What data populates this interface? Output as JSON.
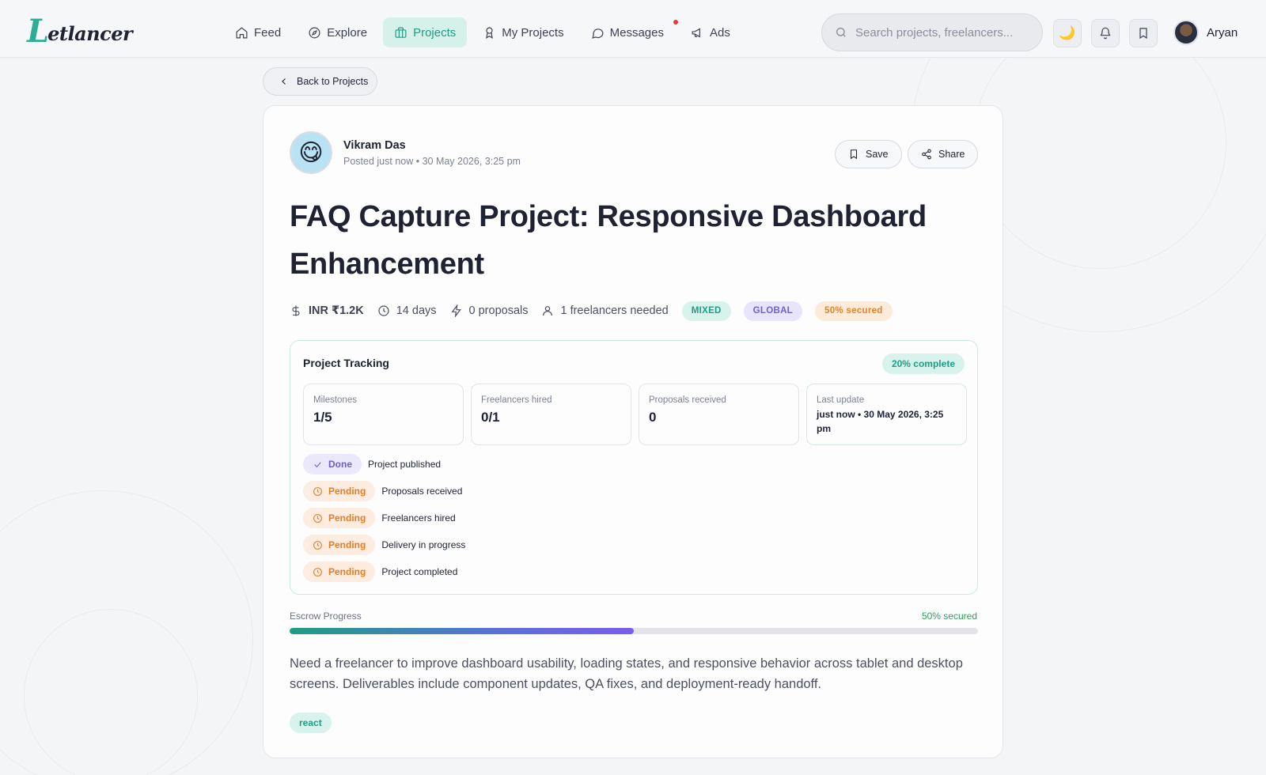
{
  "brand": {
    "logo_initial": "L",
    "logo_rest": "etlancer"
  },
  "nav": {
    "feed": "Feed",
    "explore": "Explore",
    "projects": "Projects",
    "my_projects": "My Projects",
    "messages": "Messages",
    "ads": "Ads"
  },
  "search": {
    "placeholder": "Search projects, freelancers..."
  },
  "user": {
    "name": "Aryan"
  },
  "back": {
    "label": "Back to Projects"
  },
  "post": {
    "author_name": "Vikram Das",
    "author_emoji": "😋",
    "posted": "Posted just now • 30 May 2026, 3:25 pm",
    "save_label": "Save",
    "share_label": "Share",
    "title": "FAQ Capture Project: Responsive Dashboard Enhancement",
    "budget": "INR ₹1.2K",
    "duration": "14 days",
    "proposals": "0 proposals",
    "freelancers_needed": "1 freelancers needed",
    "tags": {
      "mixed": "MIXED",
      "global": "GLOBAL",
      "secured": "50% secured"
    }
  },
  "tracking": {
    "title": "Project Tracking",
    "complete": "20% complete",
    "metrics": [
      {
        "label": "Milestones",
        "value": "1/5"
      },
      {
        "label": "Freelancers hired",
        "value": "0/1"
      },
      {
        "label": "Proposals received",
        "value": "0"
      },
      {
        "label": "Last update",
        "value": "just now • 30 May 2026, 3:25 pm"
      }
    ],
    "steps": [
      {
        "status": "Done",
        "label": "Project published"
      },
      {
        "status": "Pending",
        "label": "Proposals received"
      },
      {
        "status": "Pending",
        "label": "Freelancers hired"
      },
      {
        "status": "Pending",
        "label": "Delivery in progress"
      },
      {
        "status": "Pending",
        "label": "Project completed"
      }
    ]
  },
  "escrow": {
    "label": "Escrow Progress",
    "value": "50% secured",
    "progress": 0.5
  },
  "description": "Need a freelancer to improve dashboard usability, loading states, and responsive behavior across tablet and desktop screens. Deliverables include component updates, QA fixes, and deployment-ready handoff.",
  "skills": [
    "react"
  ],
  "colors": {
    "accent": "#1f9d83",
    "purple": "#6a5dd1",
    "orange": "#e07e28"
  },
  "icons": [
    "home-icon",
    "compass-icon",
    "briefcase-icon",
    "award-icon",
    "message-icon",
    "megaphone-icon",
    "search-icon",
    "moon-icon",
    "bell-icon",
    "bookmark-icon",
    "chevron-left-icon",
    "share-icon",
    "dollar-icon",
    "clock-icon",
    "zap-icon",
    "user-icon",
    "check-icon"
  ]
}
